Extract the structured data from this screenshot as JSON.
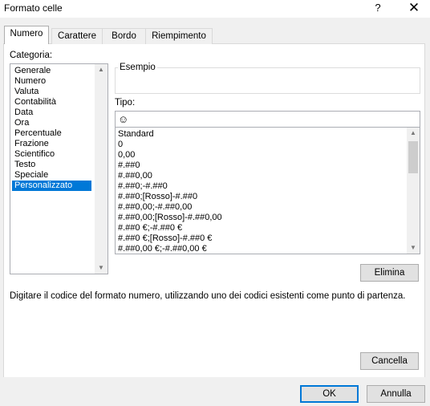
{
  "window": {
    "title": "Formato celle",
    "help": "?",
    "close": "✕"
  },
  "tabs": [
    "Numero",
    "Carattere",
    "Bordo",
    "Riempimento"
  ],
  "categoria": {
    "label": "Categoria:",
    "items": [
      "Generale",
      "Numero",
      "Valuta",
      "Contabilità",
      "Data",
      "Ora",
      "Percentuale",
      "Frazione",
      "Scientifico",
      "Testo",
      "Speciale",
      "Personalizzato"
    ],
    "selected": "Personalizzato"
  },
  "esempio": {
    "label": "Esempio",
    "value": ""
  },
  "tipo": {
    "label": "Tipo:",
    "input_value": "☺",
    "formats": [
      "Standard",
      "0",
      "0,00",
      "#.##0",
      "#.##0,00",
      "#.##0;-#.##0",
      "#.##0;[Rosso]-#.##0",
      "#.##0,00;-#.##0,00",
      "#.##0,00;[Rosso]-#.##0,00",
      "#.##0 €;-#.##0 €",
      "#.##0 €;[Rosso]-#.##0 €",
      "#.##0,00 €;-#.##0,00 €"
    ]
  },
  "buttons": {
    "elimina": "Elimina",
    "cancella": "Cancella",
    "ok": "OK",
    "annulla": "Annulla"
  },
  "description": "Digitare il codice del formato numero, utilizzando uno dei codici esistenti come punto di partenza.",
  "colors": {
    "selection": "#0078d7",
    "default_button_border": "#0078d7"
  }
}
